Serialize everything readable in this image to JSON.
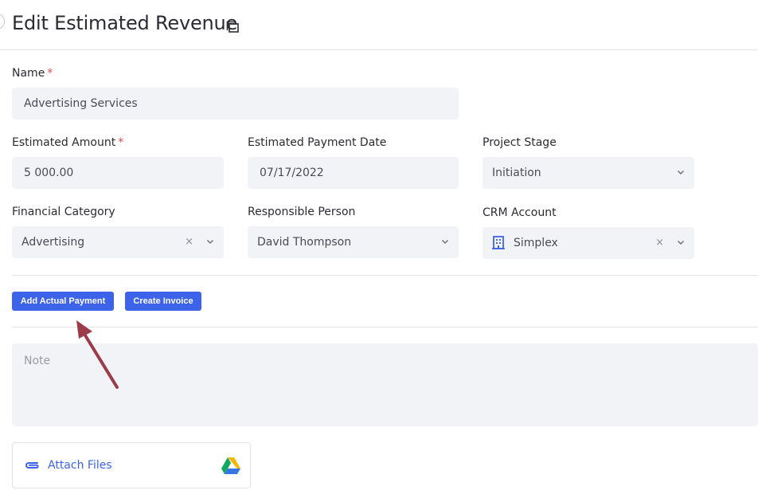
{
  "header": {
    "title": "Edit Estimated Revenue"
  },
  "form": {
    "name": {
      "label": "Name",
      "required_mark": "*",
      "value": "Advertising Services"
    },
    "estimated_amount": {
      "label": "Estimated Amount",
      "required_mark": "*",
      "value": "5 000.00"
    },
    "estimated_payment_date": {
      "label": "Estimated Payment Date",
      "value": "07/17/2022"
    },
    "project_stage": {
      "label": "Project Stage",
      "value": "Initiation"
    },
    "financial_category": {
      "label": "Financial Category",
      "value": "Advertising",
      "clear": "×"
    },
    "responsible_person": {
      "label": "Responsible Person",
      "value": "David Thompson"
    },
    "crm_account": {
      "label": "CRM Account",
      "value": "Simplex",
      "icon": "building-icon",
      "clear": "×"
    }
  },
  "actions": {
    "add_actual_payment": "Add Actual Payment",
    "create_invoice": "Create Invoice"
  },
  "note": {
    "placeholder": "Note"
  },
  "attachments": {
    "label": "Attach Files",
    "icon": "paperclip-icon",
    "drive_icon": "google-drive-icon"
  },
  "annotation": {
    "type": "arrow",
    "color": "#9b3c48"
  },
  "colors": {
    "accent": "#3d63ea",
    "field_bg": "#f2f3f7",
    "required": "#e5484d"
  }
}
